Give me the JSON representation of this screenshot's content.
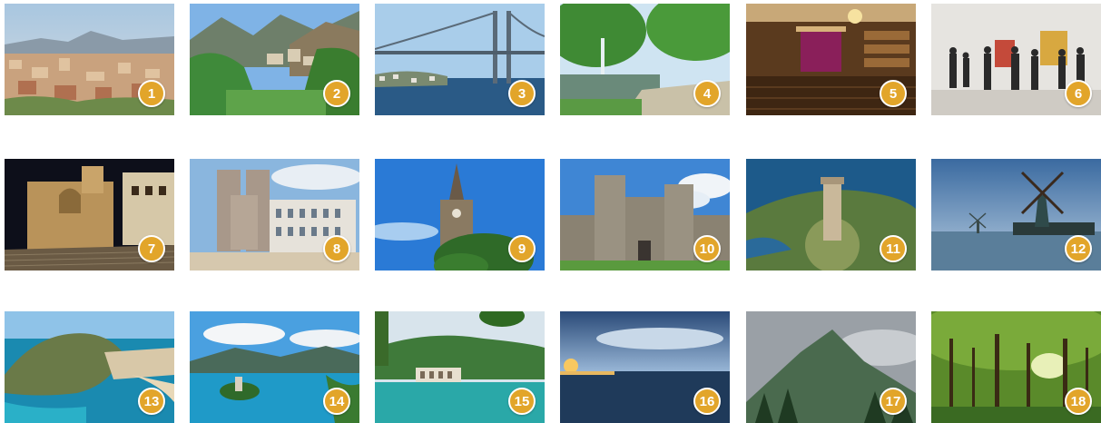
{
  "badge_color": "#e2a52a",
  "photos": [
    {
      "number": "1",
      "scene": "city-skyline"
    },
    {
      "number": "2",
      "scene": "mountain-village"
    },
    {
      "number": "3",
      "scene": "suspension-bridge"
    },
    {
      "number": "4",
      "scene": "park-fountain"
    },
    {
      "number": "5",
      "scene": "theater-interior"
    },
    {
      "number": "6",
      "scene": "art-gallery"
    },
    {
      "number": "7",
      "scene": "cathedral-night"
    },
    {
      "number": "8",
      "scene": "cathedral-facade"
    },
    {
      "number": "9",
      "scene": "church-spire"
    },
    {
      "number": "10",
      "scene": "stone-castle"
    },
    {
      "number": "11",
      "scene": "coastal-lighthouse"
    },
    {
      "number": "12",
      "scene": "windmill-river"
    },
    {
      "number": "13",
      "scene": "coastal-town"
    },
    {
      "number": "14",
      "scene": "lake-island"
    },
    {
      "number": "15",
      "scene": "lake-boathouse"
    },
    {
      "number": "16",
      "scene": "sea-sunset"
    },
    {
      "number": "17",
      "scene": "misty-mountain"
    },
    {
      "number": "18",
      "scene": "forest"
    }
  ]
}
